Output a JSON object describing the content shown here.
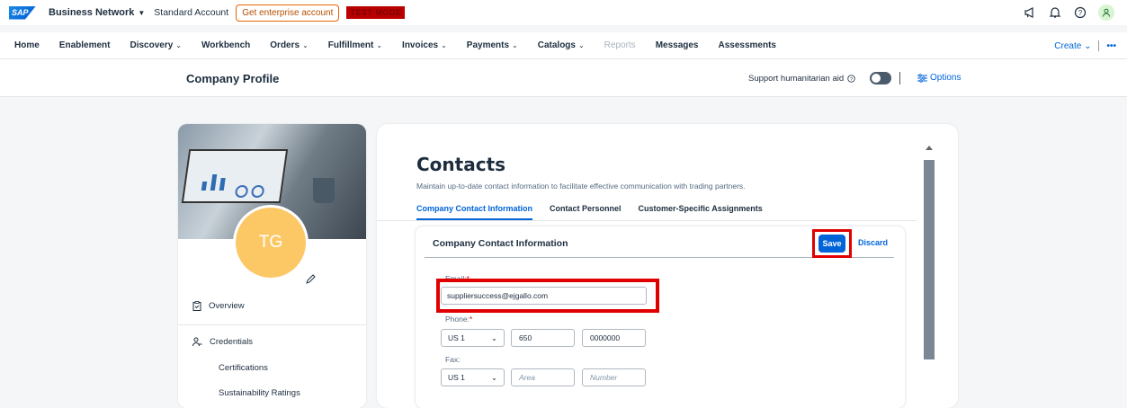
{
  "shell": {
    "logo": "SAP",
    "product": "Business Network",
    "account_type": "Standard Account",
    "enterprise_button": "Get enterprise account",
    "mode_badge": "TEST MODE",
    "icons": [
      "megaphone-icon",
      "bell-icon",
      "help-icon",
      "user-avatar-icon"
    ]
  },
  "nav": {
    "items": [
      {
        "label": "Home",
        "has_menu": false,
        "disabled": false
      },
      {
        "label": "Enablement",
        "has_menu": false,
        "disabled": false
      },
      {
        "label": "Discovery",
        "has_menu": true,
        "disabled": false
      },
      {
        "label": "Workbench",
        "has_menu": false,
        "disabled": false
      },
      {
        "label": "Orders",
        "has_menu": true,
        "disabled": false
      },
      {
        "label": "Fulfillment",
        "has_menu": true,
        "disabled": false
      },
      {
        "label": "Invoices",
        "has_menu": true,
        "disabled": false
      },
      {
        "label": "Payments",
        "has_menu": true,
        "disabled": false
      },
      {
        "label": "Catalogs",
        "has_menu": true,
        "disabled": false
      },
      {
        "label": "Reports",
        "has_menu": false,
        "disabled": true
      },
      {
        "label": "Messages",
        "has_menu": false,
        "disabled": false
      },
      {
        "label": "Assessments",
        "has_menu": false,
        "disabled": false
      }
    ],
    "create_label": "Create",
    "more_label": "•••"
  },
  "page": {
    "title": "Company Profile",
    "humanitarian_label": "Support humanitarian aid",
    "options_label": "Options"
  },
  "profile": {
    "initials": "TG",
    "overview_label": "Overview",
    "credentials_label": "Credentials",
    "certifications_label": "Certifications",
    "sustainability_label": "Sustainability Ratings"
  },
  "contacts": {
    "title": "Contacts",
    "description": "Maintain up-to-date contact information to facilitate effective communication with trading partners.",
    "tabs": [
      {
        "label": "Company Contact Information",
        "active": true
      },
      {
        "label": "Contact Personnel",
        "active": false
      },
      {
        "label": "Customer-Specific Assignments",
        "active": false
      }
    ],
    "section_title": "Company Contact Information",
    "save_label": "Save",
    "discard_label": "Discard",
    "email_label": "Email:",
    "email_value": "suppliersuccess@ejgallo.com",
    "phone_label": "Phone:",
    "phone_country": "US 1",
    "phone_area": "650",
    "phone_number": "0000000",
    "fax_label": "Fax:",
    "fax_country": "US 1",
    "fax_area_placeholder": "Area",
    "fax_number_placeholder": "Number"
  },
  "colors": {
    "accent": "#0064d9",
    "highlight": "#e00000",
    "avatar": "#fcc866"
  }
}
